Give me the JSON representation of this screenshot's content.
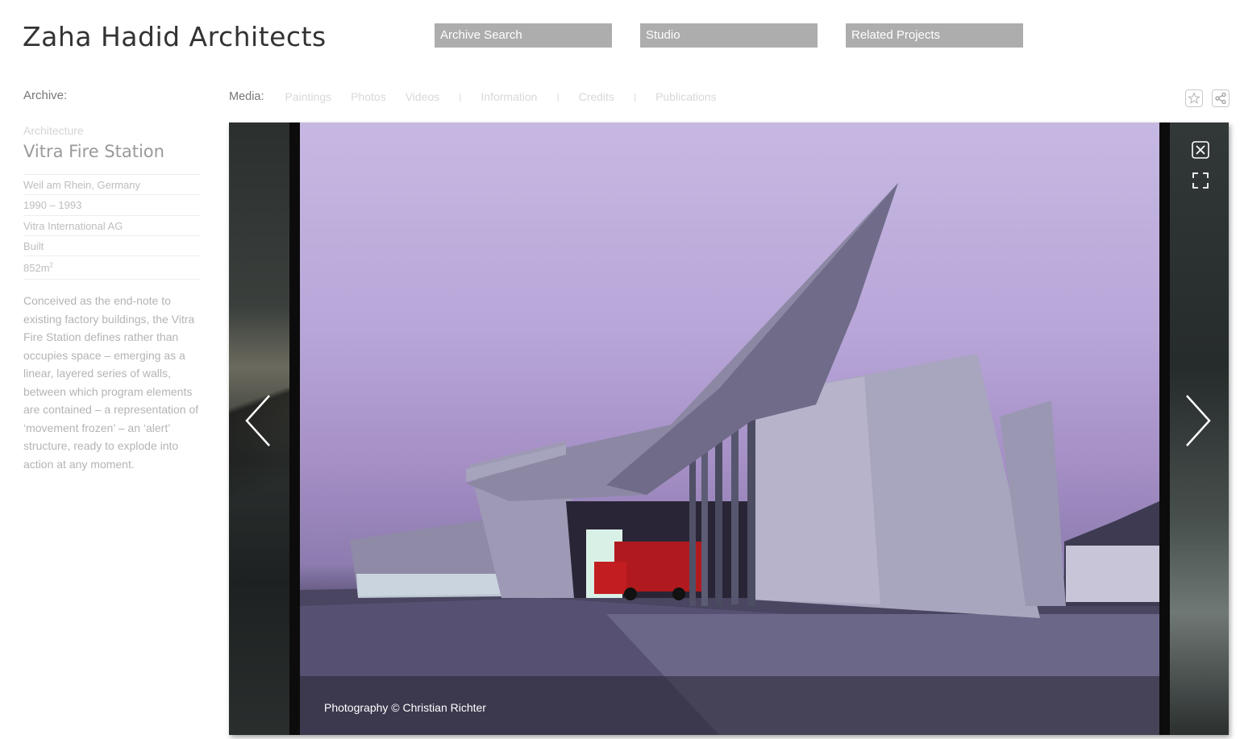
{
  "header": {
    "logo": "Zaha Hadid Architects",
    "nav": {
      "archive_search": "Archive Search",
      "studio": "Studio",
      "related_projects": "Related Projects"
    }
  },
  "sidebar": {
    "archive_label": "Archive:",
    "category": "Architecture",
    "title": "Vitra Fire Station",
    "location": "Weil am Rhein, Germany",
    "years": "1990 – 1993",
    "client": "Vitra International AG",
    "status": "Built",
    "area_value": "852m",
    "area_exponent": "2",
    "description": "Conceived as the end-note to existing factory buildings, the Vitra Fire Station defines rather than occupies space – emerging as a linear, layered series of walls, between which program elements are contained – a representation of ‘movement frozen’ – an ‘alert’ structure, ready to explode into action at any moment."
  },
  "media_bar": {
    "label": "Media:",
    "tabs": {
      "paintings": "Paintings",
      "photos": "Photos",
      "videos": "Videos",
      "information": "Information",
      "credits": "Credits",
      "publications": "Publications"
    },
    "separator": "|"
  },
  "icons": {
    "favorite": "star-icon",
    "share": "share-icon",
    "prev": "chevron-left-icon",
    "next": "chevron-right-icon",
    "close": "close-icon",
    "fullscreen": "fullscreen-icon"
  },
  "viewer": {
    "caption": "Photography © Christian Richter"
  },
  "colors": {
    "nav_bg": "#adadad",
    "viewer_bg": "#141414"
  }
}
